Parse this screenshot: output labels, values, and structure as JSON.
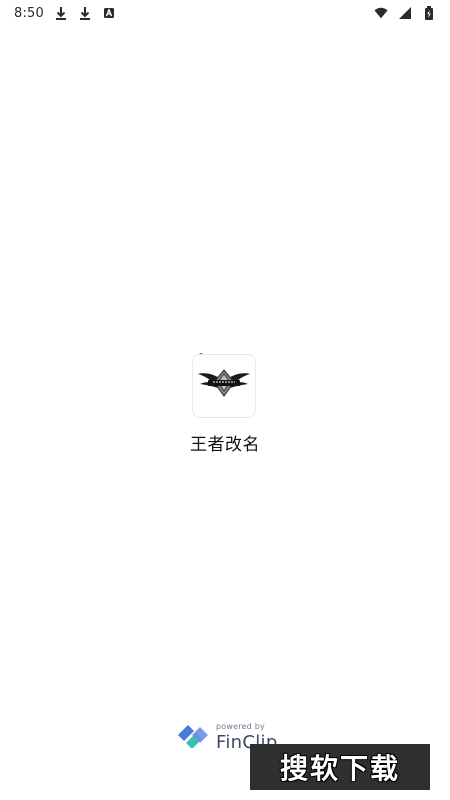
{
  "status_bar": {
    "time": "8:50",
    "left_icons": [
      "download-icon",
      "download-icon",
      "app-notification-icon"
    ],
    "right_icons": [
      "wifi-icon",
      "cell-signal-icon",
      "battery-charging-icon"
    ]
  },
  "app": {
    "name": "王者改名",
    "logo": "kog-emblem-icon"
  },
  "branding": {
    "powered_by": "powered by",
    "name": "FinClip"
  },
  "watermark": {
    "text": "搜软下载"
  },
  "colors": {
    "background": "#ffffff",
    "loading_dot": "#4a7bd8",
    "finclip_blue": "#4a7bd8",
    "finclip_teal": "#35c2b1"
  }
}
